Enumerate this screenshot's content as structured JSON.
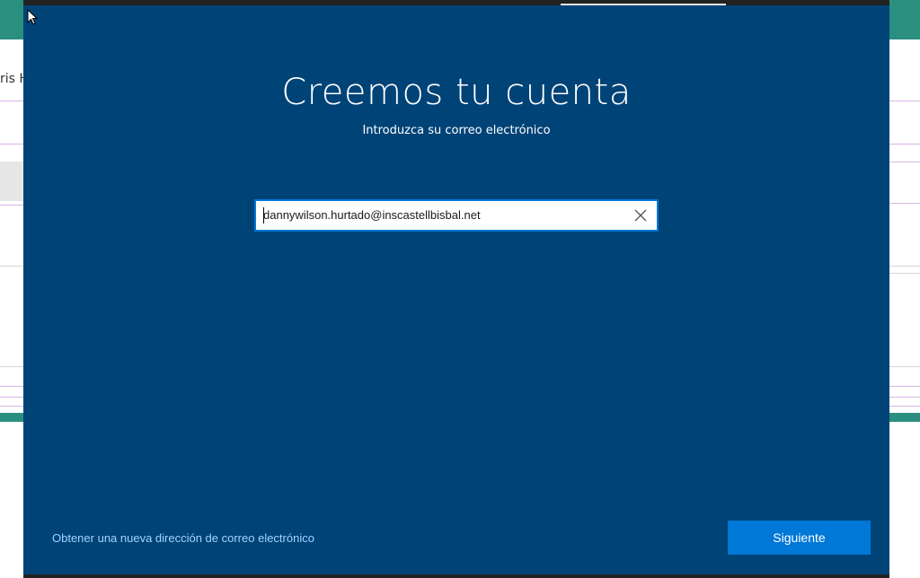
{
  "background_app": {
    "partial_text": "ris H"
  },
  "oobe": {
    "title": "Creemos tu cuenta",
    "subtitle": "Introduzca su correo electrónico",
    "email_field": {
      "value": "dannywilson.hurtado@inscastellbisbal.net"
    },
    "clear_icon": "close-icon",
    "link_label": "Obtener una nueva dirección de correo electrónico",
    "next_label": "Siguiente"
  },
  "colors": {
    "dialog_background": "#004377",
    "accent": "#0078d7",
    "link": "#9fd3ff",
    "background_app_header": "#2b8f80"
  }
}
